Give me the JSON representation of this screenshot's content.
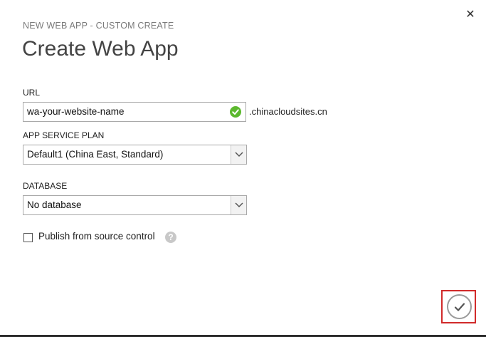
{
  "header": {
    "subtitle": "NEW WEB APP - CUSTOM CREATE",
    "title": "Create Web App"
  },
  "url": {
    "label": "URL",
    "value": "wa-your-website-name",
    "suffix": ".chinacloudsites.cn",
    "status_icon": "check-circle-icon",
    "status_color": "#5cb82e"
  },
  "app_service_plan": {
    "label": "APP SERVICE PLAN",
    "selected": "Default1 (China East, Standard)"
  },
  "database": {
    "label": "DATABASE",
    "selected": "No database"
  },
  "publish": {
    "label": "Publish from source control",
    "checked": false
  },
  "icons": {
    "close": "close-icon",
    "help": "help-icon",
    "confirm": "checkmark-icon"
  },
  "colors": {
    "highlight_frame": "#d12a2a"
  }
}
